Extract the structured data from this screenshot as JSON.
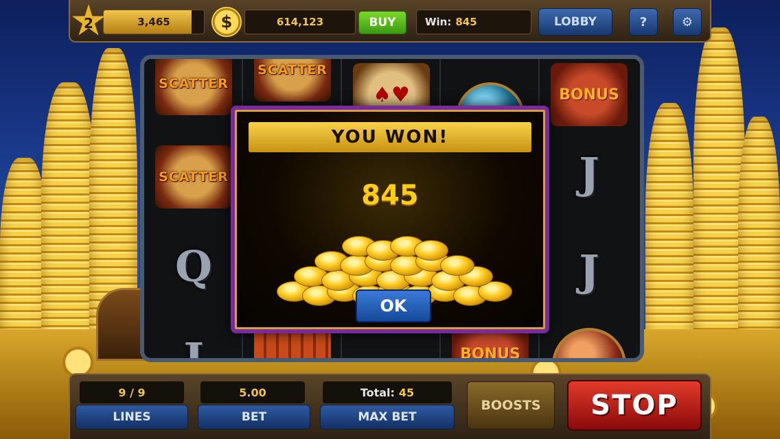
{
  "topbar": {
    "level": "2",
    "xp": "3,465",
    "xp_progress": 0.88,
    "currency_icon": "$",
    "coins": "614,123",
    "buy_label": "BUY",
    "win_label": "Win:",
    "win_value": "845",
    "lobby_label": "LOBBY",
    "help_label": "?",
    "settings_icon": "⚙"
  },
  "reels": {
    "scatter_label": "SCATTER",
    "bonus_label": "BONUS",
    "letter_j": "J",
    "letter_q": "Q",
    "cards_symbol": "♠♥"
  },
  "popup": {
    "title": "YOU WON!",
    "amount": "845",
    "ok_label": "OK"
  },
  "bottombar": {
    "lines_value": "9 / 9",
    "lines_label": "LINES",
    "bet_value": "5.00",
    "bet_label": "BET",
    "total_label": "Total:",
    "total_value": "45",
    "max_bet_label": "MAX BET",
    "boosts_label": "BOOSTS",
    "stop_label": "STOP"
  },
  "colors": {
    "gold": "#f2c54a",
    "popup_border": "#7a2a9a",
    "stop_red": "#e23a2a",
    "buy_green": "#7cd82a"
  }
}
